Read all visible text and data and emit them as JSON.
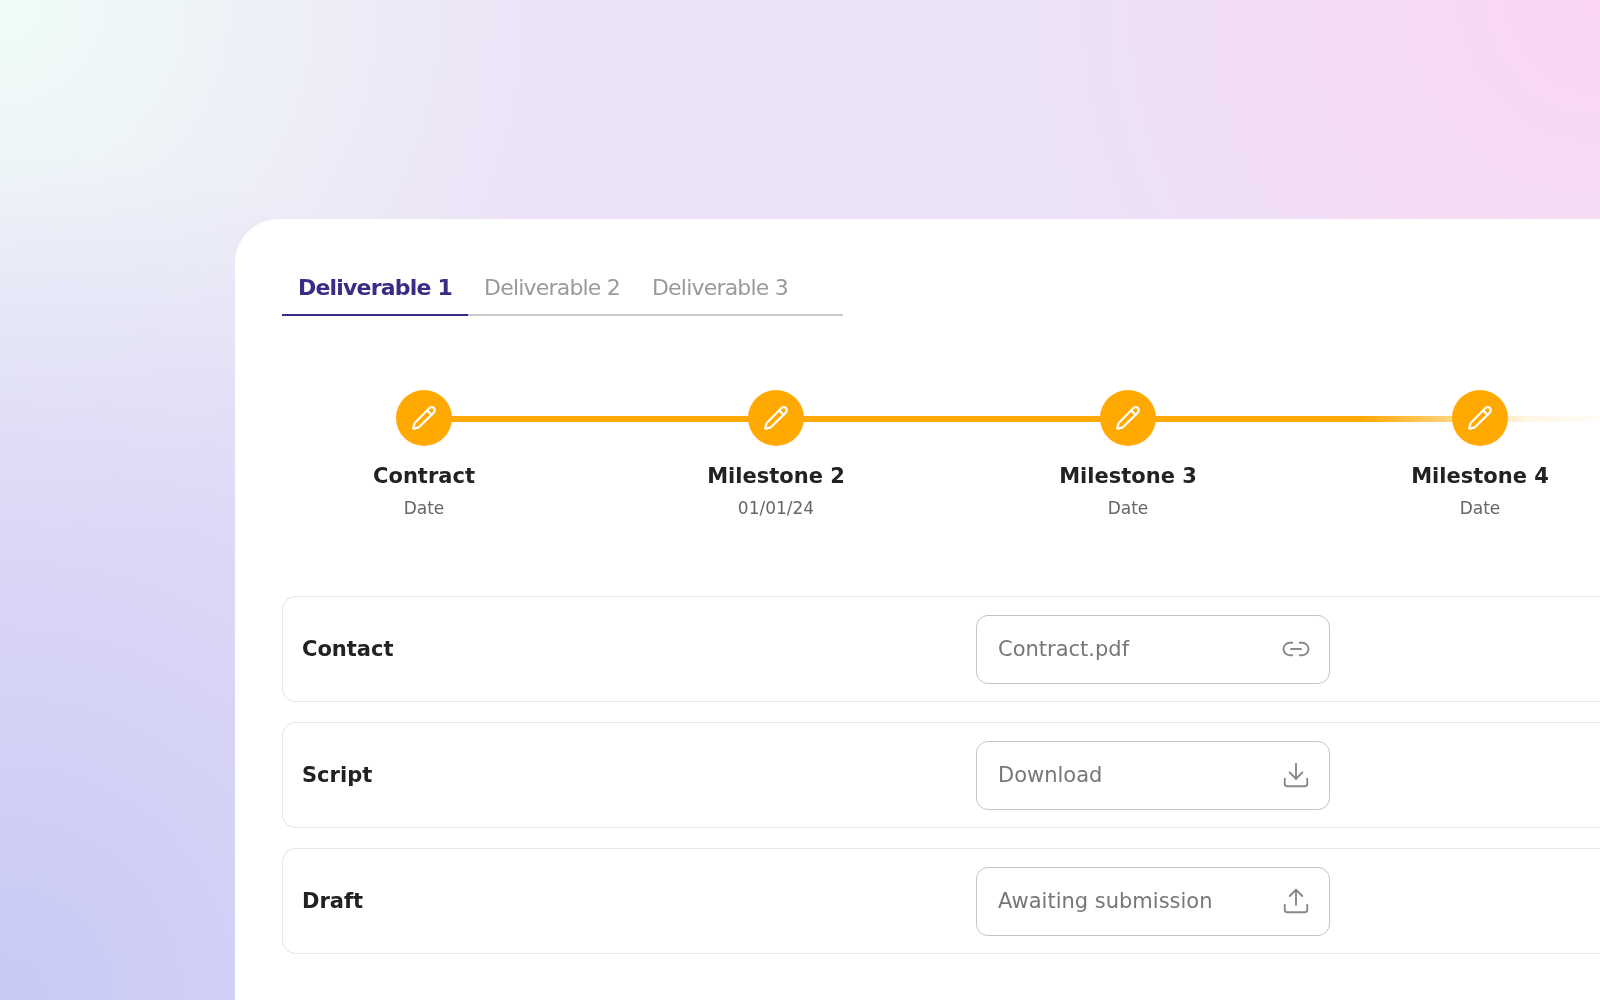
{
  "tabs": [
    {
      "label": "Deliverable 1",
      "selected": true
    },
    {
      "label": "Deliverable 2",
      "selected": false
    },
    {
      "label": "Deliverable 3",
      "selected": false
    }
  ],
  "milestones": [
    {
      "title": "Contract",
      "date": "Date"
    },
    {
      "title": "Milestone 2",
      "date": "01/01/24"
    },
    {
      "title": "Milestone 3",
      "date": "Date"
    },
    {
      "title": "Milestone 4",
      "date": "Date"
    }
  ],
  "rows": [
    {
      "label": "Contact",
      "field": "Contract.pdf",
      "kind": "link"
    },
    {
      "label": "Script",
      "field": "Download",
      "kind": "download"
    },
    {
      "label": "Draft",
      "field": "Awaiting submission",
      "kind": "upload"
    }
  ]
}
